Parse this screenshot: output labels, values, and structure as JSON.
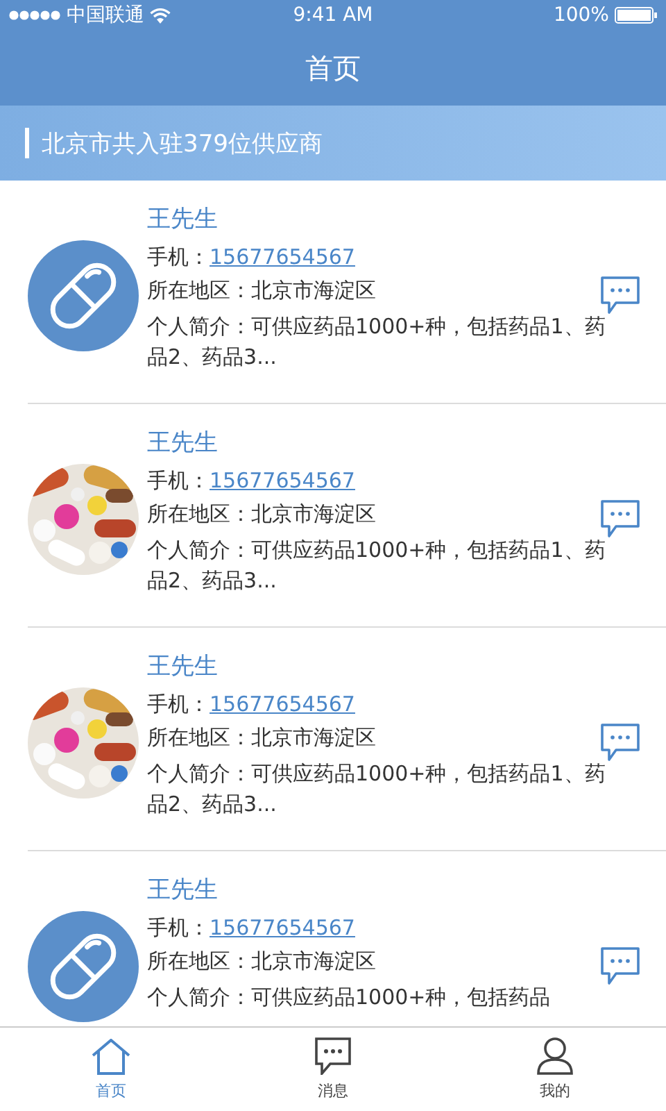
{
  "status_bar": {
    "carrier": "中国联通",
    "time": "9:41 AM",
    "battery": "100%"
  },
  "nav": {
    "title": "首页"
  },
  "banner": {
    "text": "北京市共入驻379位供应商"
  },
  "suppliers": [
    {
      "avatar": {
        "kind": "icon"
      },
      "name": "王先生",
      "phone_label": "手机：",
      "phone": "15677654567",
      "region_label": "所在地区：",
      "region": "北京市海淀区",
      "intro": "个人简介：可供应药品1000+种，包括药品1、药品2、药品3..."
    },
    {
      "name": "王先生",
      "phone_label": "手机：",
      "phone": "15677654567",
      "region_label": "所在地区：",
      "region": "北京市海淀区",
      "intro": "个人简介：可供应药品1000+种，包括药品1、药品2、药品3..."
    },
    {
      "name": "王先生",
      "phone_label": "手机：",
      "phone": "15677654567",
      "region_label": "所在地区：",
      "region": "北京市海淀区",
      "intro": "个人简介：可供应药品1000+种，包括药品1、药品2、药品3..."
    },
    {
      "avatar": {
        "kind": "icon"
      },
      "name": "王先生",
      "phone_label": "手机：",
      "phone": "15677654567",
      "region_label": "所在地区：",
      "region": "北京市海淀区",
      "intro": "个人简介：可供应药品1000+种，包括药品"
    }
  ],
  "tab_bar": [
    {
      "kind": "home",
      "label": "首页",
      "selected": true
    },
    {
      "kind": "message",
      "label": "消息",
      "selected": false
    },
    {
      "kind": "profile",
      "label": "我的",
      "selected": false
    }
  ]
}
